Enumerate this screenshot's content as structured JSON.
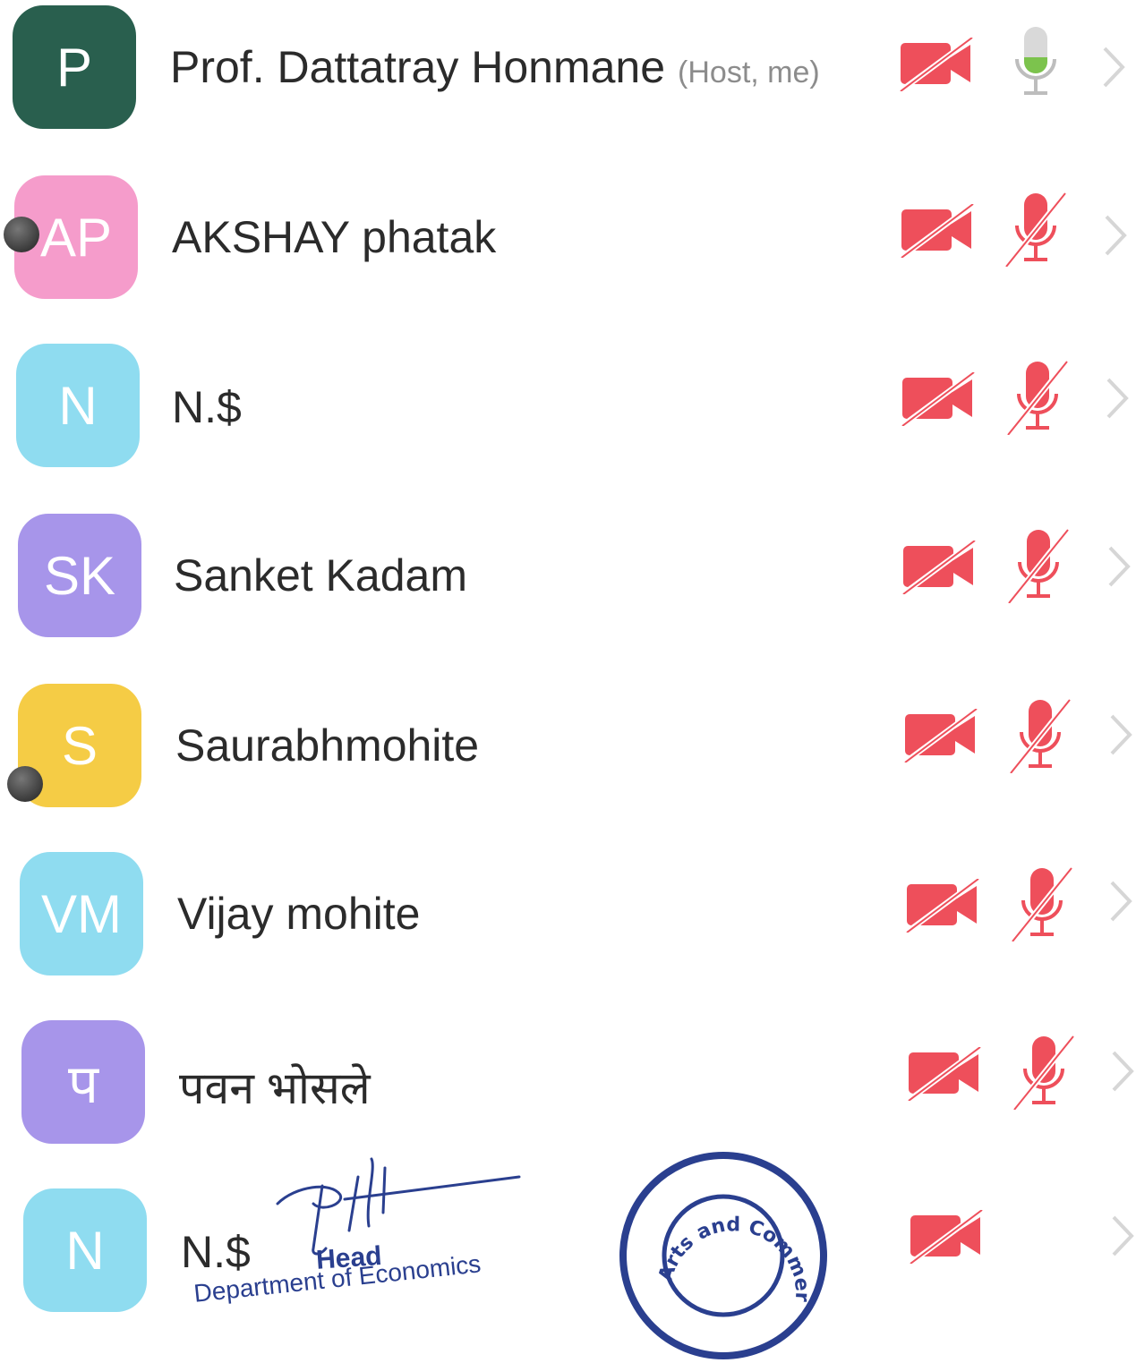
{
  "participants": [
    {
      "initials": "P",
      "name": "Prof. Dattatray Honmane",
      "tag": "(Host, me)",
      "avatar_color": "#295f4e",
      "video": "off",
      "audio": "on"
    },
    {
      "initials": "AP",
      "name": "AKSHAY phatak",
      "tag": "",
      "avatar_color": "#f59ccb",
      "video": "off",
      "audio": "muted"
    },
    {
      "initials": "N",
      "name": "N.$",
      "tag": "",
      "avatar_color": "#8fdcf0",
      "video": "off",
      "audio": "muted"
    },
    {
      "initials": "SK",
      "name": "Sanket Kadam",
      "tag": "",
      "avatar_color": "#a795ea",
      "video": "off",
      "audio": "muted"
    },
    {
      "initials": "S",
      "name": "Saurabhmohite",
      "tag": "",
      "avatar_color": "#f5cc45",
      "video": "off",
      "audio": "muted"
    },
    {
      "initials": "VM",
      "name": "Vijay mohite",
      "tag": "",
      "avatar_color": "#8fdcf0",
      "video": "off",
      "audio": "muted"
    },
    {
      "initials": "प",
      "name": "पवन भोसले",
      "tag": "",
      "avatar_color": "#a795ea",
      "video": "off",
      "audio": "muted"
    },
    {
      "initials": "N",
      "name": "N.$",
      "tag": "",
      "avatar_color": "#8fdcf0",
      "video": "off",
      "audio": "none"
    }
  ],
  "signature": {
    "title": "Head",
    "department": "Department of Economics"
  },
  "seal": {
    "text": "Arts and Commerce College, Kadegaon"
  },
  "icons": {
    "video": "video-off-icon",
    "mic_on": "microphone-icon",
    "mic_off": "microphone-muted-icon",
    "chevron": "chevron-right-icon"
  },
  "colors": {
    "muted_red": "#ee4f5b",
    "mic_active_green": "#7cc34d",
    "chevron_gray": "#d6d6d6",
    "stamp_blue": "#2a3f8f"
  }
}
